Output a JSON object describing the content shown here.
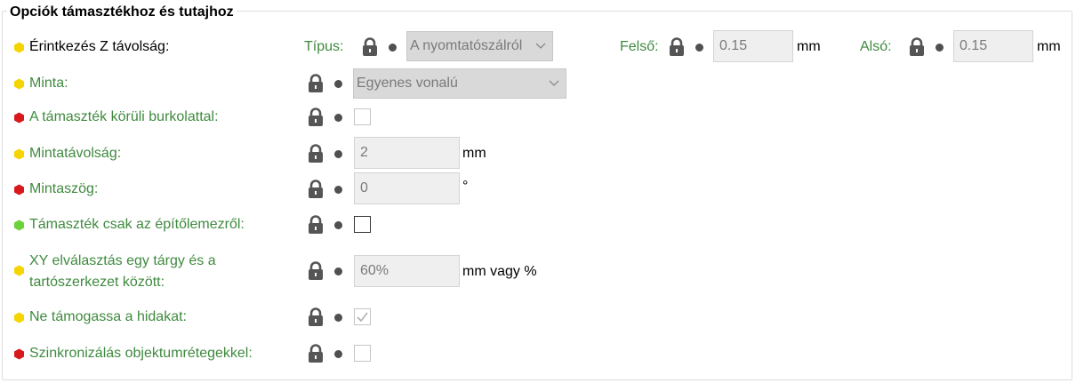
{
  "group": {
    "title": "Opciók támasztékhoz és tutajhoz"
  },
  "rows": {
    "z_distance": {
      "label": "Érintkezés Z távolság:",
      "status": "yellow",
      "type_label": "Típus:",
      "type_value": "A nyomtatószálról",
      "top_label": "Felső:",
      "top_value": "0.15",
      "top_unit": "mm",
      "bottom_label": "Alsó:",
      "bottom_value": "0.15",
      "bottom_unit": "mm"
    },
    "pattern": {
      "label": "Minta:",
      "status": "yellow",
      "value": "Egyenes vonalú"
    },
    "with_sheath": {
      "label": "A támaszték körüli burkolattal:",
      "status": "red",
      "checked": false
    },
    "pattern_spacing": {
      "label": "Mintatávolság:",
      "status": "yellow",
      "value": "2",
      "unit": "mm"
    },
    "pattern_angle": {
      "label": "Mintaszög:",
      "status": "red",
      "value": "0",
      "unit": "°"
    },
    "buildplate_only": {
      "label": "Támaszték csak az építőlemezről:",
      "status": "green",
      "checked": false
    },
    "xy_separation": {
      "label": "XY elválasztás egy tárgy és a tartószerkezet között:",
      "status": "yellow",
      "value": "60%",
      "unit": "mm vagy %"
    },
    "dont_support_bridges": {
      "label": "Ne támogassa a hidakat:",
      "status": "yellow",
      "checked": true
    },
    "sync_layers": {
      "label": "Szinkronizálás objektumrétegekkel:",
      "status": "red",
      "checked": false
    }
  },
  "colors": {
    "yellow": "#f5d400",
    "red": "#d7191c",
    "green": "#6cd23c",
    "label_green": "#3f8a3f"
  },
  "icons": {
    "lock": "lock-icon",
    "bullet": "bullet-icon",
    "chevron": "chevron-down-icon",
    "check": "checkmark-icon"
  }
}
